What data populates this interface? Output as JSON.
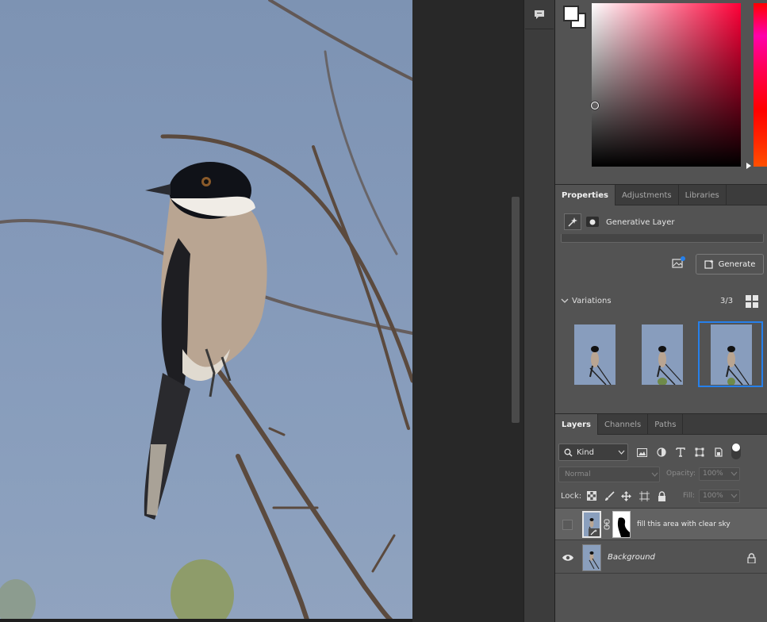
{
  "properties_tabs": [
    {
      "label": "Properties",
      "active": true
    },
    {
      "label": "Adjustments",
      "active": false
    },
    {
      "label": "Libraries",
      "active": false
    }
  ],
  "properties": {
    "layer_type_label": "Generative Layer",
    "generate_button_label": "Generate",
    "variations_label": "Variations",
    "variations_count": "3/3",
    "selected_variation": 3
  },
  "layers_tabs": [
    {
      "label": "Layers",
      "active": true
    },
    {
      "label": "Channels",
      "active": false
    },
    {
      "label": "Paths",
      "active": false
    }
  ],
  "layers": {
    "filter_kind": "Kind",
    "blend_mode": "Normal",
    "opacity_label": "Opacity:",
    "opacity_value": "100%",
    "lock_label": "Lock:",
    "fill_label": "Fill:",
    "fill_value": "100%",
    "items": [
      {
        "name": "fill this area with clear sky",
        "visible": false,
        "selected": true
      },
      {
        "name": "Background",
        "visible": true,
        "locked": true
      }
    ]
  },
  "colors": {
    "foreground": "#ffffff",
    "background": "#ffffff",
    "accent": "#2680eb"
  }
}
